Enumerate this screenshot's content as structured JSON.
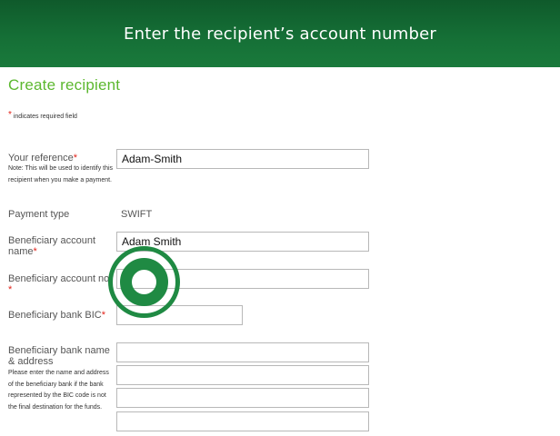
{
  "banner": {
    "title": "Enter the recipient’s account number"
  },
  "form": {
    "title": "Create recipient",
    "required_star": "*",
    "required_note": "indicates required field",
    "your_reference": {
      "label": "Your reference",
      "note": "Note: This will be used to identify this recipient when you make a payment.",
      "value": "Adam-Smith"
    },
    "payment_type": {
      "label": "Payment type",
      "value": "SWIFT"
    },
    "beneficiary_account_name": {
      "label": "Beneficiary account name",
      "value": "Adam Smith"
    },
    "beneficiary_account_number": {
      "label": "Beneficiary account no",
      "value": ""
    },
    "beneficiary_bank_bic": {
      "label": "Beneficiary bank BIC",
      "value": ""
    },
    "beneficiary_bank_name_address": {
      "label": "Beneficiary bank name & address",
      "note": "Please enter the name and address of the beneficiary bank if the bank represented by the BIC code is not the final destination for the funds.",
      "lines": [
        "",
        "",
        "",
        ""
      ]
    }
  },
  "overlay": {
    "icon": "tap-target-ring-icon",
    "color": "#1f8a43"
  },
  "colors": {
    "banner": "#156f36",
    "title": "#5cb82f",
    "required": "#e2231a"
  }
}
